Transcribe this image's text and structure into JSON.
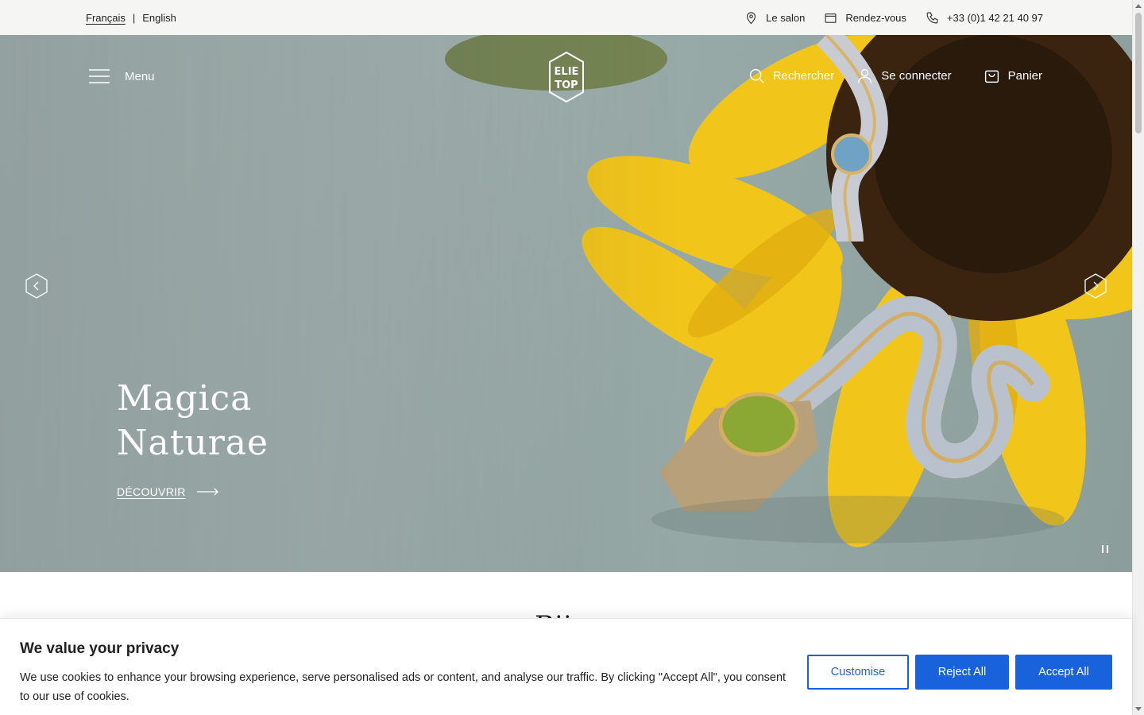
{
  "topbar": {
    "languages": [
      {
        "label": "Français",
        "active": true
      },
      {
        "label": "English",
        "active": false
      }
    ],
    "separator": "|",
    "utilities": [
      {
        "icon": "map-pin-icon",
        "label": "Le salon"
      },
      {
        "icon": "calendar-icon",
        "label": "Rendez-vous"
      },
      {
        "icon": "phone-icon",
        "label": "+33 (0)1 42 21 40 97"
      }
    ]
  },
  "header": {
    "menu_label": "Menu",
    "logo_text": [
      "ELIE",
      "TOP"
    ],
    "search_label": "Rechercher",
    "account_label": "Se connecter",
    "cart_label": "Panier"
  },
  "hero": {
    "title_line1": "Magica",
    "title_line2": "Naturae",
    "cta_label": "DÉCOUVRIR"
  },
  "section": {
    "peek_title": "Bij..."
  },
  "cookie_banner": {
    "title": "We value your privacy",
    "text": "We use cookies to enhance your browsing experience, serve personalised ads or content, and analyse our traffic. By clicking \"Accept All\", you consent to our use of cookies.",
    "customise_label": "Customise",
    "reject_label": "Reject All",
    "accept_label": "Accept All"
  },
  "colors": {
    "accent": "#1863dc",
    "topbar_bg": "#f5f5f4",
    "flower_yellow": "#f2c51a"
  }
}
